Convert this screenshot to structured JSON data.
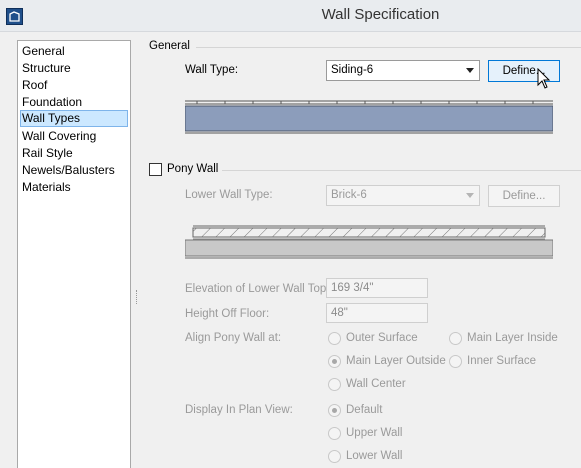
{
  "window": {
    "title": "Wall Specification"
  },
  "sidebar": {
    "items": [
      {
        "label": "General"
      },
      {
        "label": "Structure"
      },
      {
        "label": "Roof"
      },
      {
        "label": "Foundation"
      },
      {
        "label": "Wall Types",
        "selected": true
      },
      {
        "label": "Wall Covering"
      },
      {
        "label": "Rail Style"
      },
      {
        "label": "Newels/Balusters"
      },
      {
        "label": "Materials"
      }
    ]
  },
  "general": {
    "group_label": "General",
    "wall_type_label": "Wall Type:",
    "wall_type_value": "Siding-6",
    "define_label": "Define..."
  },
  "pony": {
    "checkbox_label": "Pony Wall",
    "checked": false,
    "lower_wall_type_label": "Lower Wall Type:",
    "lower_wall_type_value": "Brick-6",
    "define_label": "Define...",
    "elevation_label": "Elevation of Lower Wall Top:",
    "elevation_value": "169 3/4\"",
    "height_label": "Height Off Floor:",
    "height_value": "48\"",
    "align_label": "Align Pony Wall at:",
    "align_options": [
      {
        "label": "Outer Surface",
        "checked": false
      },
      {
        "label": "Main Layer Inside",
        "checked": false
      },
      {
        "label": "Main Layer Outside",
        "checked": true
      },
      {
        "label": "Inner Surface",
        "checked": false
      },
      {
        "label": "Wall Center",
        "checked": false
      }
    ],
    "display_label": "Display In Plan View:",
    "display_options": [
      {
        "label": "Default",
        "checked": true
      },
      {
        "label": "Upper Wall",
        "checked": false
      },
      {
        "label": "Lower Wall",
        "checked": false
      }
    ]
  },
  "colors": {
    "selection_bg": "#cce8ff",
    "selection_border": "#7eb4ea",
    "wall_main_layer": "#8c9dbb",
    "button_hover_border": "#0078d7"
  }
}
